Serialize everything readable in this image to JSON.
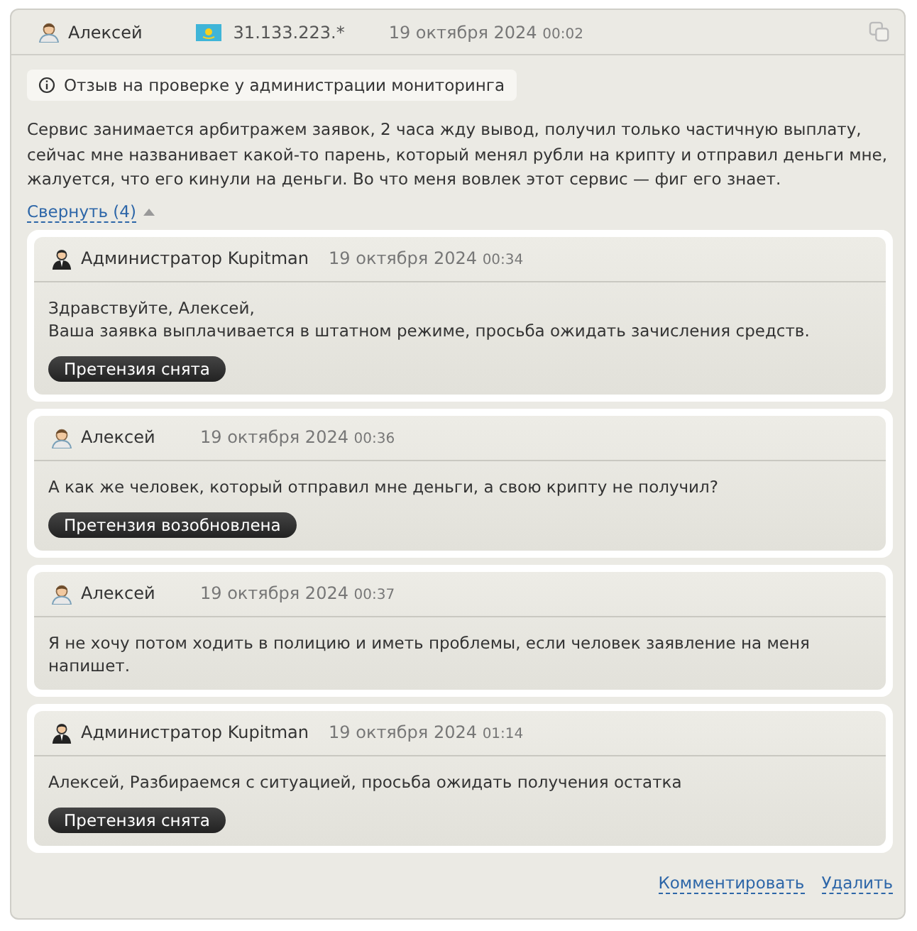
{
  "review": {
    "author": "Алексей",
    "ip": "31.133.223.*",
    "date": "19 октября 2024",
    "time": "00:02",
    "notice": "Отзыв на проверке у администрации мониторинга",
    "text": "Сервис занимается арбитражем заявок, 2 часа жду вывод, получил только частичную выплату, сейчас мне названивает какой-то парень, который менял рубли на крипту и отправил деньги мне, жалуется, что его кинули на деньги. Во что меня вовлек этот сервис — фиг его знает.",
    "collapse": "Свернуть (4)"
  },
  "replies": [
    {
      "kind": "admin",
      "author": "Администратор Kupitman",
      "date": "19 октября 2024",
      "time": "00:34",
      "lines": [
        "Здравствуйте, Алексей,",
        "Ваша заявка выплачивается в штатном режиме, просьба ожидать зачисления средств."
      ],
      "badge": "Претензия снята"
    },
    {
      "kind": "user",
      "author": "Алексей",
      "date": "19 октября 2024",
      "time": "00:36",
      "lines": [
        "А как же человек, который отправил мне деньги, а свою крипту не получил?"
      ],
      "badge": "Претензия возобновлена"
    },
    {
      "kind": "user",
      "author": "Алексей",
      "date": "19 октября 2024",
      "time": "00:37",
      "lines": [
        "Я не хочу потом ходить в полицию и иметь проблемы, если человек заявление на меня напишет."
      ]
    },
    {
      "kind": "admin",
      "author": "Администратор Kupitman",
      "date": "19 октября 2024",
      "time": "01:14",
      "lines": [
        "Алексей, Разбираемся с ситуацией, просьба ожидать получения остатка"
      ],
      "badge": "Претензия снята"
    }
  ],
  "actions": [
    "Комментировать",
    "Удалить"
  ]
}
